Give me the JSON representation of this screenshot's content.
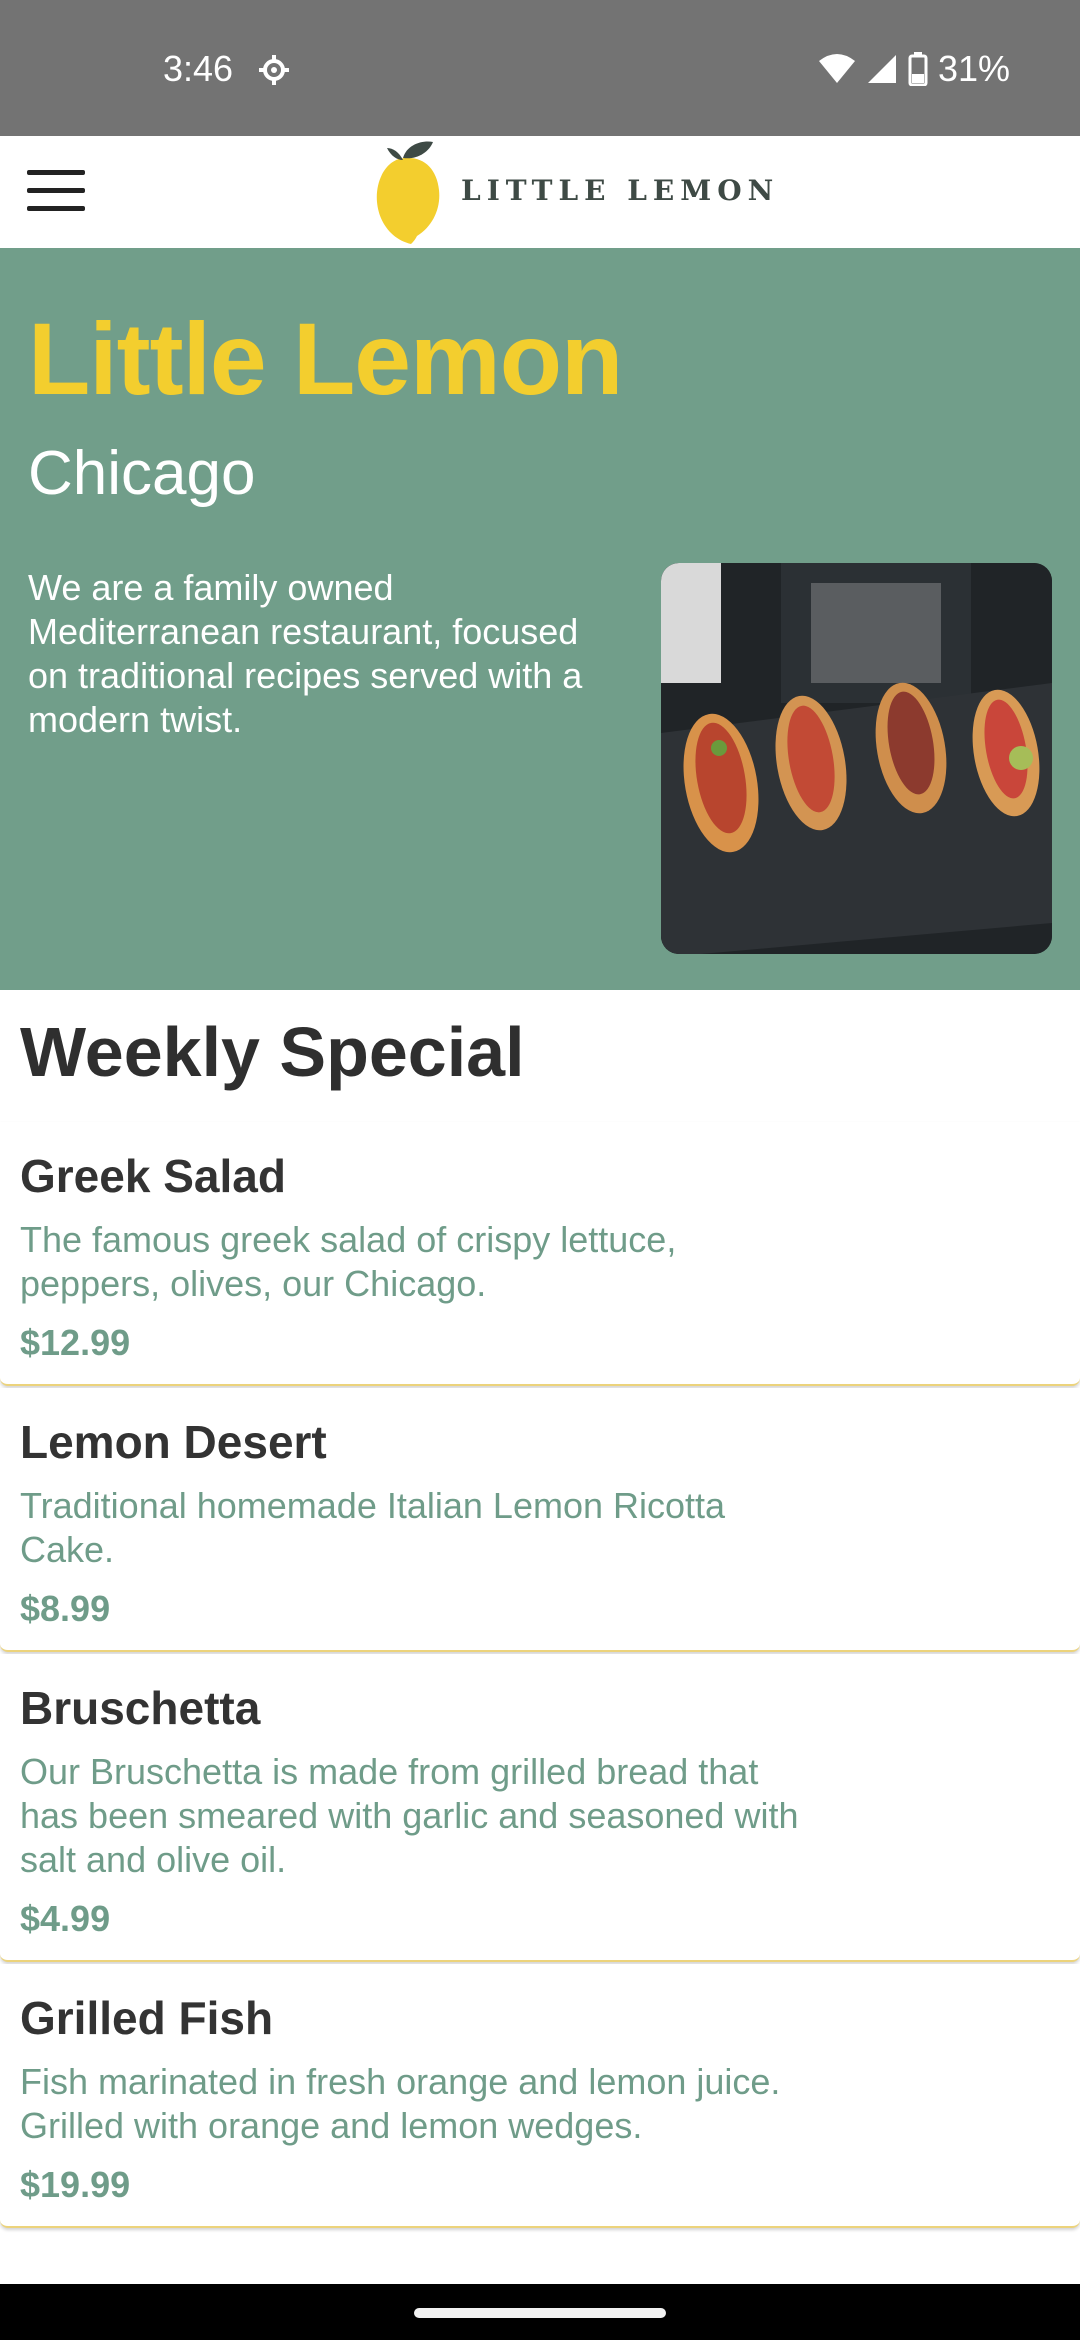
{
  "status_bar": {
    "time": "3:46",
    "battery": "31%",
    "icons": [
      "settings-gear-icon",
      "wifi-icon",
      "signal-icon",
      "battery-icon"
    ]
  },
  "app_bar": {
    "menu_icon": "hamburger-menu-icon",
    "logo_text": "LITTLE LEMON"
  },
  "hero": {
    "title": "Little Lemon",
    "city": "Chicago",
    "description": "We are a family owned Mediterranean restaurant, focused on traditional recipes served with a modern twist."
  },
  "weekly_special": {
    "title": "Weekly Special",
    "items": [
      {
        "name": "Greek Salad",
        "description": "The famous greek salad of crispy lettuce, peppers, olives, our Chicago.",
        "price": "$12.99"
      },
      {
        "name": "Lemon Desert",
        "description": "Traditional homemade Italian Lemon Ricotta Cake.",
        "price": "$8.99"
      },
      {
        "name": "Bruschetta",
        "description": "Our Bruschetta is made from grilled bread that has been smeared with garlic and seasoned with salt and olive oil.",
        "price": "$4.99"
      },
      {
        "name": "Grilled Fish",
        "description": "Fish marinated in fresh orange and lemon juice. Grilled with orange and lemon wedges.",
        "price": "$19.99"
      }
    ]
  },
  "colors": {
    "hero_green": "#719e8a",
    "lemon_yellow": "#f3ce2e",
    "text_dark": "#333333",
    "accent_green": "#6f9c89"
  }
}
